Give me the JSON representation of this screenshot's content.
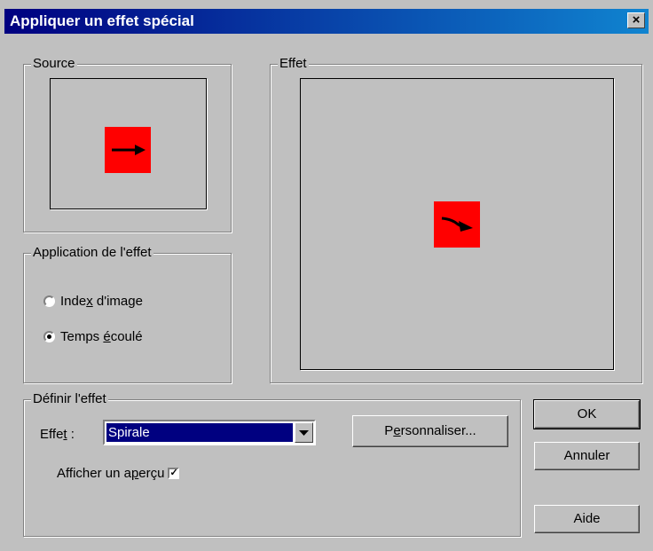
{
  "window": {
    "title": "Appliquer un effet spécial",
    "close_label": "×"
  },
  "source": {
    "legend": "Source"
  },
  "effet_preview": {
    "legend": "Effet"
  },
  "application": {
    "legend": "Application de l'effet",
    "options": [
      {
        "pre": "Inde",
        "key": "x",
        "post": " d'image",
        "selected": false
      },
      {
        "pre": "Temps ",
        "key": "é",
        "post": "coulé",
        "selected": true
      }
    ]
  },
  "definir": {
    "legend": "Définir l'effet",
    "effet_label_pre": "Effe",
    "effet_label_key": "t",
    "effet_label_post": " :",
    "effet_value": "Spirale",
    "personnaliser_pre": "P",
    "personnaliser_key": "e",
    "personnaliser_post": "rsonnaliser...",
    "apercu_pre": "Afficher un a",
    "apercu_key": "p",
    "apercu_post": "erçu",
    "apercu_checked": true,
    "apercu_mark": "✓"
  },
  "buttons": {
    "ok": "OK",
    "cancel": "Annuler",
    "help": "Aide"
  },
  "colors": {
    "preview_fill": "#ff0000",
    "title_bg": "#000080"
  },
  "icons": {
    "source_arrow": "right-arrow-icon",
    "effect_arrow": "spiral-arrow-icon"
  }
}
